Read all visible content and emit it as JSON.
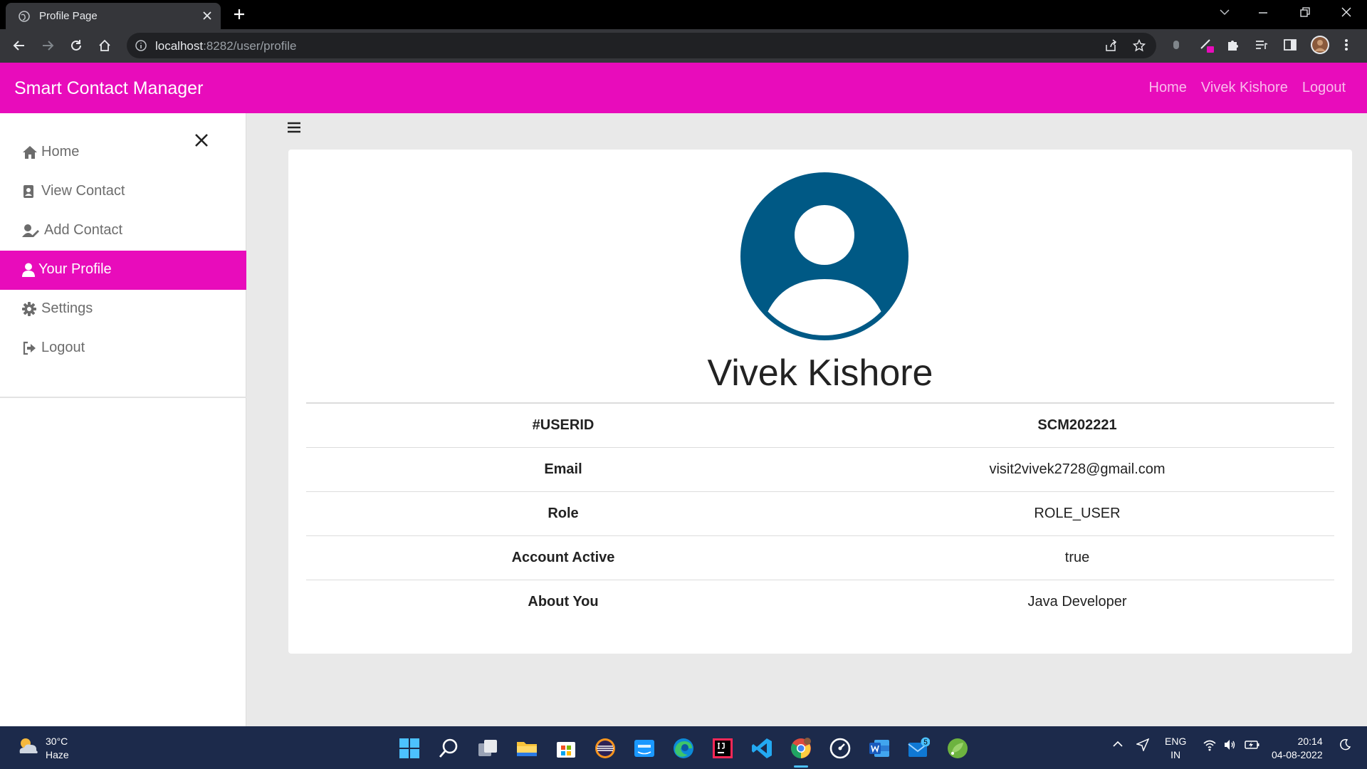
{
  "browser": {
    "tab_title": "Profile Page",
    "url_host": "localhost",
    "url_rest": ":8282/user/profile"
  },
  "app": {
    "brand": "Smart Contact Manager",
    "nav": {
      "home": "Home",
      "user": "Vivek Kishore",
      "logout": "Logout"
    }
  },
  "sidebar": {
    "items": [
      {
        "label": "Home",
        "icon": "home-icon"
      },
      {
        "label": "View Contact",
        "icon": "address-book-icon"
      },
      {
        "label": "Add Contact",
        "icon": "user-edit-icon"
      },
      {
        "label": "Your Profile",
        "icon": "user-icon",
        "active": true
      },
      {
        "label": "Settings",
        "icon": "gear-icon"
      },
      {
        "label": "Logout",
        "icon": "sign-out-icon"
      }
    ]
  },
  "profile": {
    "name": "Vivek Kishore",
    "rows": [
      {
        "key": "#USERID",
        "value": "SCM202221"
      },
      {
        "key": "Email",
        "value": "visit2vivek2728@gmail.com"
      },
      {
        "key": "Role",
        "value": "ROLE_USER"
      },
      {
        "key": "Account Active",
        "value": "true"
      },
      {
        "key": "About You",
        "value": "Java Developer"
      }
    ]
  },
  "taskbar": {
    "temperature": "30°C",
    "weather": "Haze",
    "lang_top": "ENG",
    "lang_bottom": "IN",
    "time": "20:14",
    "date": "04-08-2022",
    "mail_badge": "5"
  },
  "colors": {
    "accent": "#e80cbb",
    "avatar": "#005985",
    "taskbar": "#1c2a4b"
  }
}
